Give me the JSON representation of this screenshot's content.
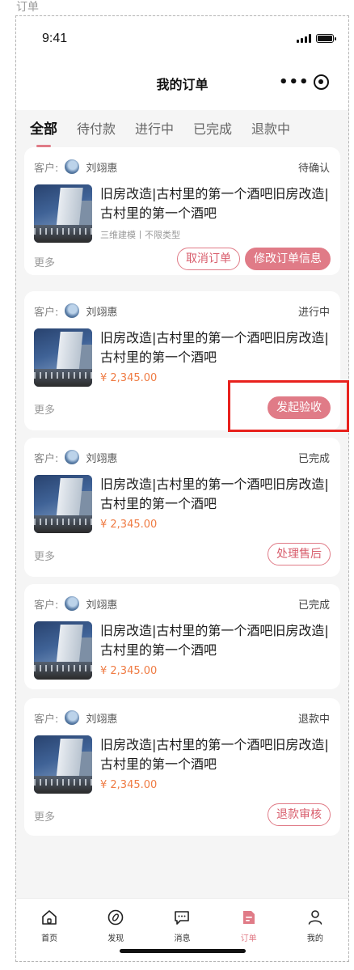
{
  "artboard_label": "订单",
  "status_bar": {
    "time": "9:41"
  },
  "nav": {
    "title": "我的订单",
    "more_icon": "more-dots-icon",
    "close_icon": "target-circle-icon"
  },
  "tabs": [
    {
      "label": "全部",
      "active": true
    },
    {
      "label": "待付款",
      "active": false
    },
    {
      "label": "进行中",
      "active": false
    },
    {
      "label": "已完成",
      "active": false
    },
    {
      "label": "退款中",
      "active": false
    }
  ],
  "orders": [
    {
      "customer_label": "客户:",
      "customer_name": "刘翊惠",
      "status": "待确认",
      "title": "旧房改造|古村里的第一个酒吧旧房改造|古村里的第一个酒吧",
      "meta": "三维建模丨不限类型",
      "more": "更多",
      "actions": [
        {
          "label": "取消订单",
          "style": "outline"
        },
        {
          "label": "修改订单信息",
          "style": "filled"
        }
      ]
    },
    {
      "customer_label": "客户:",
      "customer_name": "刘翊惠",
      "status": "进行中",
      "title": "旧房改造|古村里的第一个酒吧旧房改造|古村里的第一个酒吧",
      "price": "¥ 2,345.00",
      "more": "更多",
      "actions": [
        {
          "label": "发起验收",
          "style": "filled"
        }
      ]
    },
    {
      "customer_label": "客户:",
      "customer_name": "刘翊惠",
      "status": "已完成",
      "title": "旧房改造|古村里的第一个酒吧旧房改造|古村里的第一个酒吧",
      "price": "¥ 2,345.00",
      "more": "更多",
      "actions": [
        {
          "label": "处理售后",
          "style": "outline"
        }
      ]
    },
    {
      "customer_label": "客户:",
      "customer_name": "刘翊惠",
      "status": "已完成",
      "title": "旧房改造|古村里的第一个酒吧旧房改造|古村里的第一个酒吧",
      "price": "¥ 2,345.00"
    },
    {
      "customer_label": "客户:",
      "customer_name": "刘翊惠",
      "status": "退款中",
      "title": "旧房改造|古村里的第一个酒吧旧房改造|古村里的第一个酒吧",
      "price": "¥ 2,345.00",
      "more": "更多",
      "actions": [
        {
          "label": "退款审核",
          "style": "outline"
        }
      ]
    }
  ],
  "tabbar": [
    {
      "label": "首页",
      "icon": "home-icon",
      "active": false
    },
    {
      "label": "发现",
      "icon": "compass-icon",
      "active": false
    },
    {
      "label": "消息",
      "icon": "message-icon",
      "active": false
    },
    {
      "label": "订单",
      "icon": "order-icon",
      "active": true
    },
    {
      "label": "我的",
      "icon": "user-icon",
      "active": false
    }
  ],
  "colors": {
    "accent": "#e07b87",
    "price": "#ef7b43",
    "highlight": "#e8211d"
  }
}
